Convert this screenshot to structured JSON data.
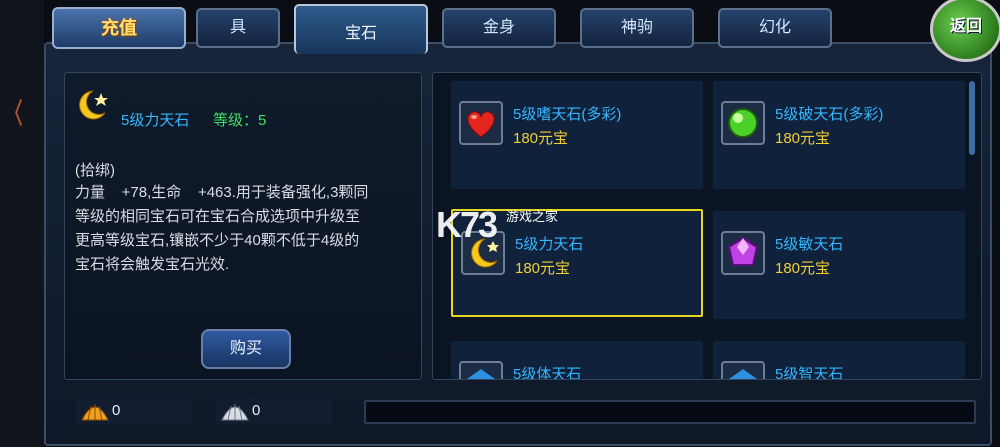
{
  "header": {
    "recharge_label": "充值",
    "back_label": "返回",
    "tabs": [
      {
        "label": "具",
        "active": false
      },
      {
        "label": "宝石",
        "active": true
      },
      {
        "label": "金身",
        "active": false
      },
      {
        "label": "神驹",
        "active": false
      },
      {
        "label": "幻化",
        "active": false
      }
    ]
  },
  "detail": {
    "icon": "moon-star-icon",
    "name": "5级力天石",
    "level_label": "等级：5",
    "bind_text": "(拾绑)",
    "description": "力量    +78,生命    +463.用于装备强化,3颗同\n等级的相同宝石可在宝石合成选项中升级至\n更高等级宝石,镶嵌不少于40颗不低于4级的\n宝石将会触发宝石光效.",
    "buy_label": "购买"
  },
  "gems": [
    {
      "name": "5级嗜天石(多彩)",
      "price": "180元宝",
      "icon": "heart-gem-icon",
      "selected": false
    },
    {
      "name": "5级破天石(多彩)",
      "price": "180元宝",
      "icon": "green-orb-icon",
      "selected": false
    },
    {
      "name": "5级力天石",
      "price": "180元宝",
      "icon": "moon-star-icon",
      "selected": true
    },
    {
      "name": "5级敏天石",
      "price": "180元宝",
      "icon": "purple-gem-icon",
      "selected": false
    },
    {
      "name": "5级体天石",
      "price": "",
      "icon": "blue-gem-icon",
      "selected": false
    },
    {
      "name": "5级智天石",
      "price": "",
      "icon": "blue-gem-icon",
      "selected": false
    }
  ],
  "watermark": {
    "logo": "K73",
    "site": "游戏之家"
  },
  "currency": [
    {
      "icon": "gold-shell-icon",
      "value": "0"
    },
    {
      "icon": "silver-shell-icon",
      "value": "0"
    }
  ],
  "colors": {
    "accent": "#36b6ff",
    "price": "#f2cf35",
    "level": "#3be069",
    "selection": "#e7d624"
  }
}
